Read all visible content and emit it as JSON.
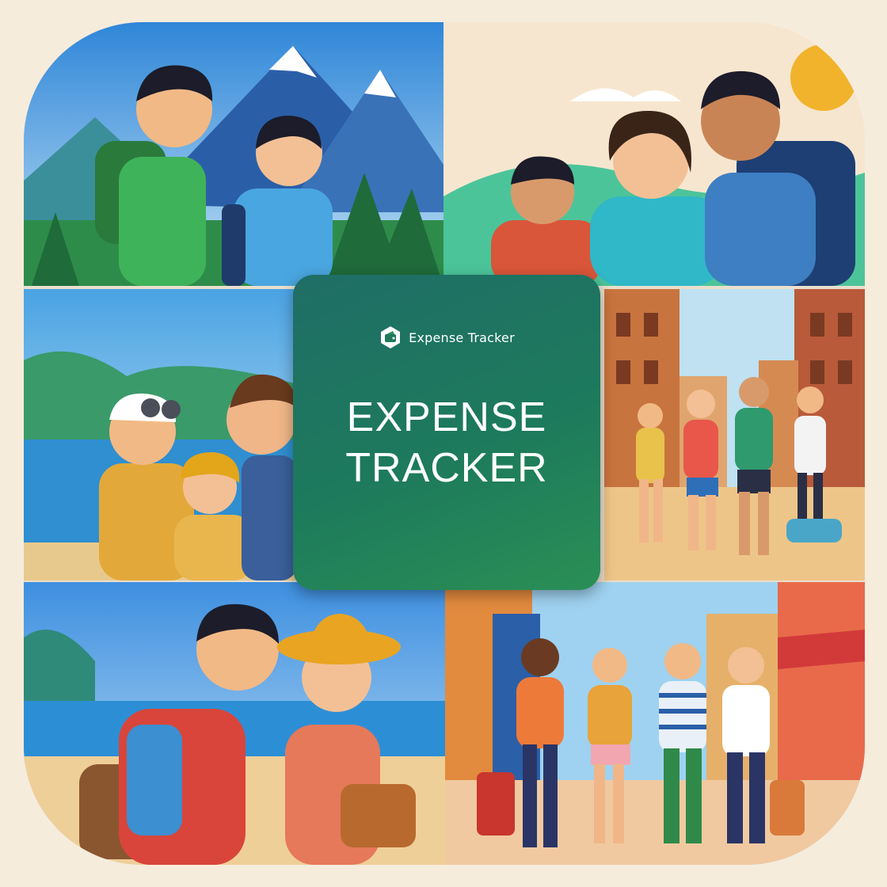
{
  "brand": {
    "name": "Expense Tracker",
    "logo_icon": "wallet-hexagon-icon"
  },
  "headline": {
    "line1": "EXPENSE",
    "line2": "TRACKER"
  },
  "colors": {
    "page_background": "#f6ecdc",
    "card_gradient_start": "#1f6e66",
    "card_gradient_end": "#2a8f55",
    "text": "#ffffff"
  },
  "illustrations": [
    {
      "scene": "mountain-hikers"
    },
    {
      "scene": "family-travelers"
    },
    {
      "scene": "beach-family"
    },
    {
      "scene": "city-street-walkers"
    },
    {
      "scene": "beach-couple"
    },
    {
      "scene": "city-travelers-luggage"
    }
  ]
}
